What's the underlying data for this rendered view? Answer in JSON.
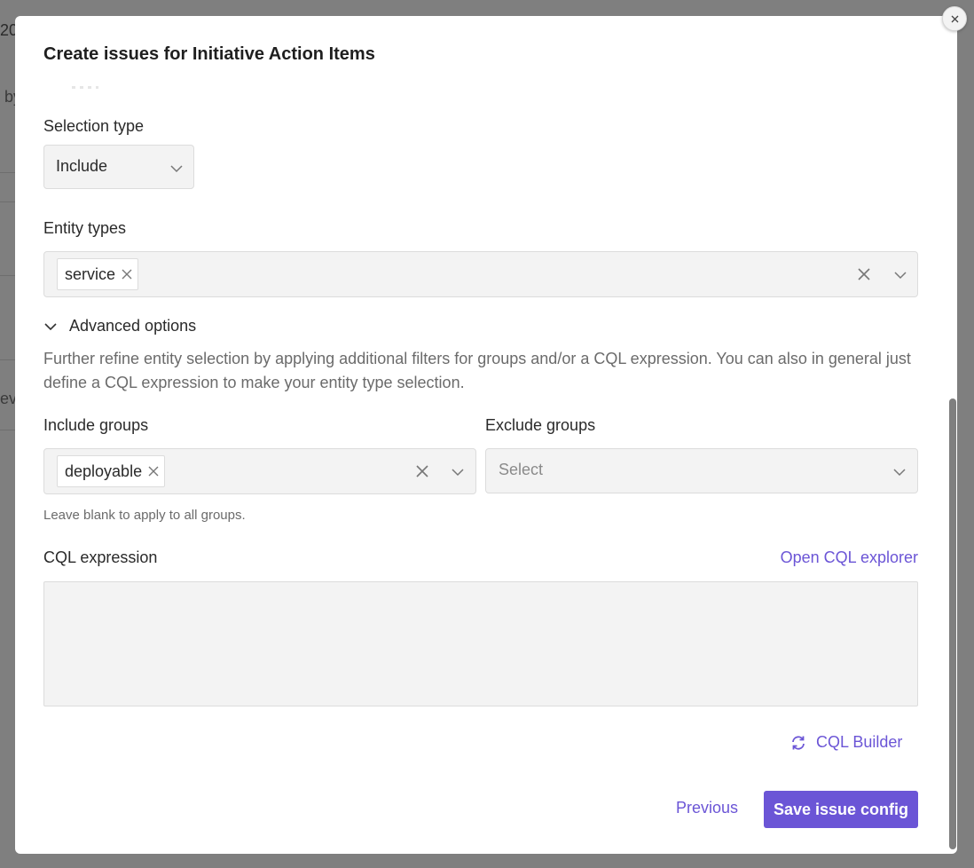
{
  "backdrop": {
    "fragments": [
      "20",
      "by",
      "ev"
    ]
  },
  "modal": {
    "title": "Create issues for Initiative Action Items",
    "close_icon": "close-icon",
    "selection_type": {
      "label": "Selection type",
      "value": "Include"
    },
    "entity_types": {
      "label": "Entity types",
      "chips": [
        "service"
      ]
    },
    "advanced_options": {
      "label": "Advanced options",
      "expanded": true,
      "description": "Further refine entity selection by applying additional filters for groups and/or a CQL expression. You can also in general just define a CQL expression to make your entity type selection."
    },
    "include_groups": {
      "label": "Include groups",
      "chips": [
        "deployable"
      ],
      "hint": "Leave blank to apply to all groups."
    },
    "exclude_groups": {
      "label": "Exclude groups",
      "placeholder": "Select"
    },
    "cql_expression": {
      "label": "CQL expression",
      "explorer_link": "Open CQL explorer",
      "value": ""
    },
    "cql_builder_label": "CQL Builder",
    "footer": {
      "previous_label": "Previous",
      "save_label": "Save issue config"
    }
  },
  "colors": {
    "accent": "#6b55d6",
    "field_bg": "#f3f3f3",
    "backdrop": "#7f7f7f"
  }
}
